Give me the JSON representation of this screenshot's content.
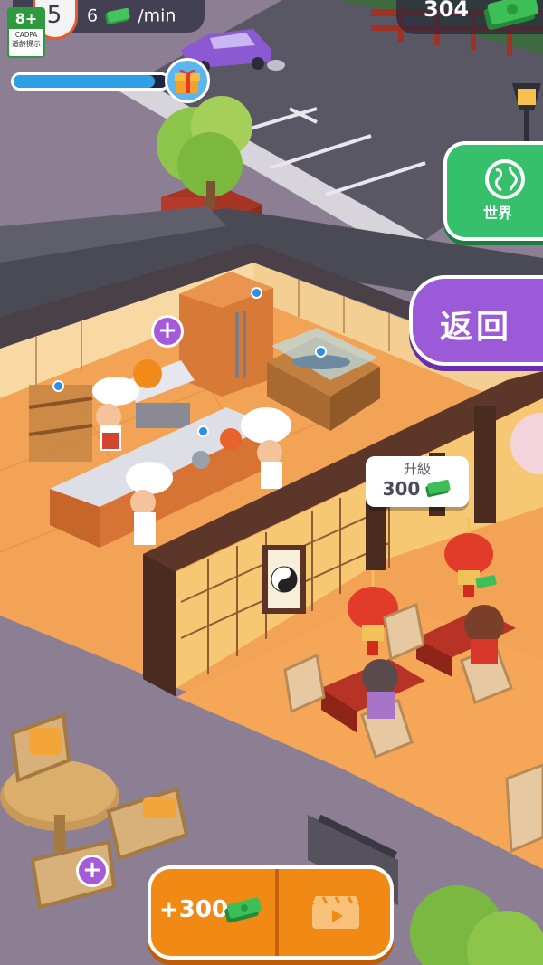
{
  "rating": {
    "age": "8+",
    "org": "CADPA",
    "hint": "适龄提示"
  },
  "player": {
    "level": "5"
  },
  "income": {
    "amount": "6",
    "unit": "/min"
  },
  "money": {
    "balance": "304"
  },
  "progress": {
    "fraction": 0.92
  },
  "buttons": {
    "world_label": "世界",
    "back_label": "返回",
    "upgrade_title": "升級",
    "upgrade_cost": "300",
    "bonus_label": "+300"
  },
  "icons": {
    "cash": "cash-icon",
    "gift": "gift-icon",
    "globe": "globe-icon",
    "video": "video-ad-icon",
    "plus": "plus-icon",
    "yin_yang": "yin-yang-icon"
  },
  "colors": {
    "accent_green": "#36c06b",
    "accent_purple": "#9b5ad8",
    "accent_orange": "#f08a14",
    "progress_blue": "#2ea0e6"
  }
}
